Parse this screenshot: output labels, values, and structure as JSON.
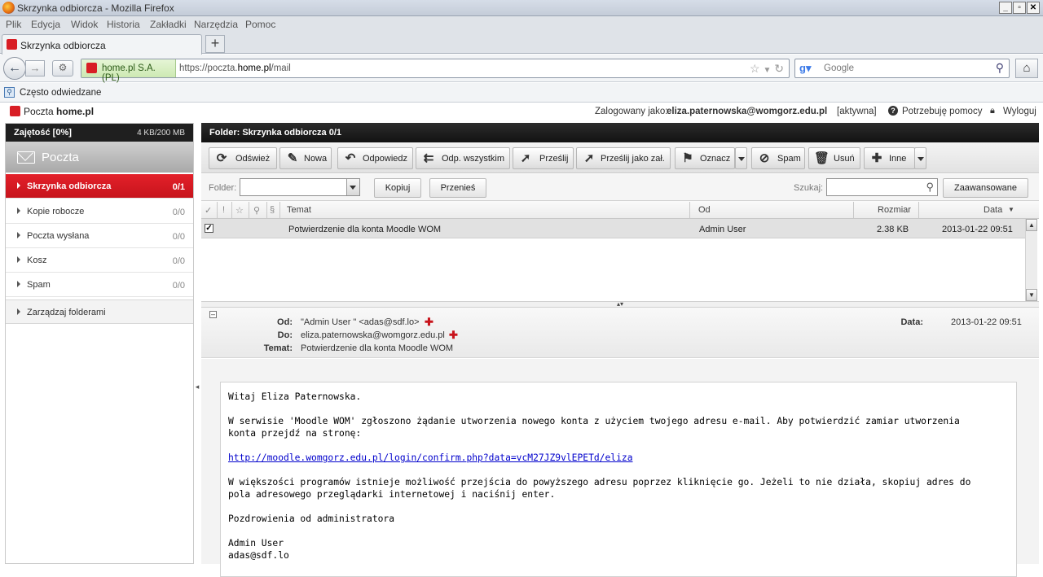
{
  "window": {
    "title": "Skrzynka odbiorcza - Mozilla Firefox"
  },
  "menu": [
    "Plik",
    "Edycja",
    "Widok",
    "Historia",
    "Zakładki",
    "Narzędzia",
    "Pomoc"
  ],
  "tab": {
    "label": "Skrzynka odbiorcza",
    "new_tab": "+"
  },
  "navbar": {
    "identity": "home.pl S.A. (PL)",
    "url_prefix": "https://poczta.",
    "url_domain": "home.pl",
    "url_path": "/mail",
    "search_placeholder": "Google"
  },
  "bookmarks": {
    "label": "Często odwiedzane"
  },
  "app_header": {
    "brand_prefix": "Poczta ",
    "brand_name": "home.pl",
    "logged_as_label": "Zalogowany jako:",
    "user": "eliza.paternowska@womgorz.edu.pl",
    "status": "[aktywna]",
    "help": "Potrzebuję pomocy",
    "logout": "Wyloguj"
  },
  "sidebar": {
    "quota_label": "Zajętość [0%]",
    "quota_value": "4 KB/200 MB",
    "section_title": "Poczta",
    "folders": [
      {
        "name": "Skrzynka odbiorcza",
        "count": "0/1",
        "active": true
      },
      {
        "name": "Kopie robocze",
        "count": "0/0"
      },
      {
        "name": "Poczta wysłana",
        "count": "0/0"
      },
      {
        "name": "Kosz",
        "count": "0/0"
      },
      {
        "name": "Spam",
        "count": "0/0"
      }
    ],
    "manage": "Zarządzaj folderami"
  },
  "folder_bar": {
    "title": "Folder: Skrzynka odbiorcza 0/1"
  },
  "toolbar": {
    "refresh": "Odśwież",
    "new": "Nowa",
    "reply": "Odpowiedz",
    "reply_all": "Odp. wszystkim",
    "forward": "Prześlij",
    "forward_attach": "Prześlij jako zał.",
    "mark": "Oznacz",
    "spam": "Spam",
    "delete": "Usuń",
    "other": "Inne"
  },
  "filter": {
    "folder_label": "Folder:",
    "copy": "Kopiuj",
    "move": "Przenieś",
    "search_label": "Szukaj:",
    "advanced": "Zaawansowane"
  },
  "list": {
    "columns": {
      "subject": "Temat",
      "from": "Od",
      "size": "Rozmiar",
      "date": "Data"
    },
    "rows": [
      {
        "subject": "Potwierdzenie dla konta Moodle WOM",
        "from": "Admin User",
        "size": "2.38 KB",
        "date": "2013-01-22 09:51",
        "checked": true
      }
    ]
  },
  "message": {
    "from_label": "Od:",
    "from": "\"Admin User \" <adas@sdf.lo>",
    "to_label": "Do:",
    "to": "eliza.paternowska@womgorz.edu.pl",
    "subject_label": "Temat:",
    "subject": "Potwierdzenie dla konta Moodle WOM",
    "date_label": "Data:",
    "date": "2013-01-22 09:51",
    "body": {
      "greeting": "Witaj Eliza Paternowska.",
      "p1_line1": "W serwisie 'Moodle WOM' zgłoszono żądanie utworzenia nowego konta z użyciem twojego adresu e-mail. Aby potwierdzić zamiar utworzenia",
      "p1_line2": "konta przejdź na stronę:",
      "link": "http://moodle.womgorz.edu.pl/login/confirm.php?data=vcM27JZ9vlEPETd/eliza",
      "p2_line1": "W większości programów istnieje możliwość przejścia do powyższego adresu poprzez kliknięcie go. Jeżeli to nie działa, skopiuj adres do",
      "p2_line2": "pola adresowego przeglądarki internetowej i naciśnij enter.",
      "closing": "Pozdrowienia od administratora",
      "sig_name": "Admin User",
      "sig_email": "adas@sdf.lo"
    }
  }
}
